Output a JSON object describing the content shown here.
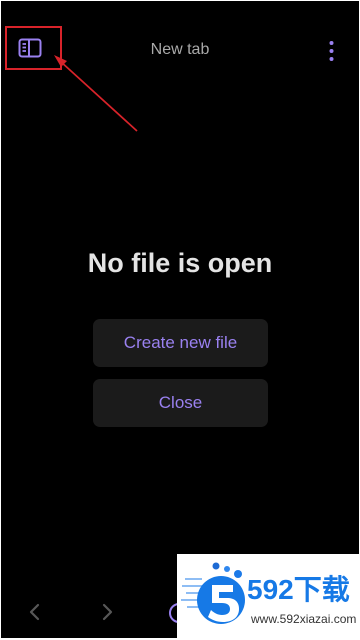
{
  "header": {
    "title": "New tab",
    "sidebar_toggle_icon": "sidebar-panel-icon",
    "more_icon": "more-vertical-icon"
  },
  "main": {
    "empty_title": "No file is open",
    "create_button": "Create new file",
    "close_button": "Close"
  },
  "bottom_nav": {
    "back_icon": "chevron-left-icon",
    "forward_icon": "chevron-right-icon",
    "circle_icon": "circle-button-icon"
  },
  "watermark": {
    "brand": "592下载",
    "domain": "www.592xiazai.com"
  },
  "colors": {
    "background": "#000000",
    "accent": "#9a81f0",
    "button_bg": "#1b1b1b",
    "annotation": "#d8232a",
    "watermark_blue": "#1679e6"
  }
}
